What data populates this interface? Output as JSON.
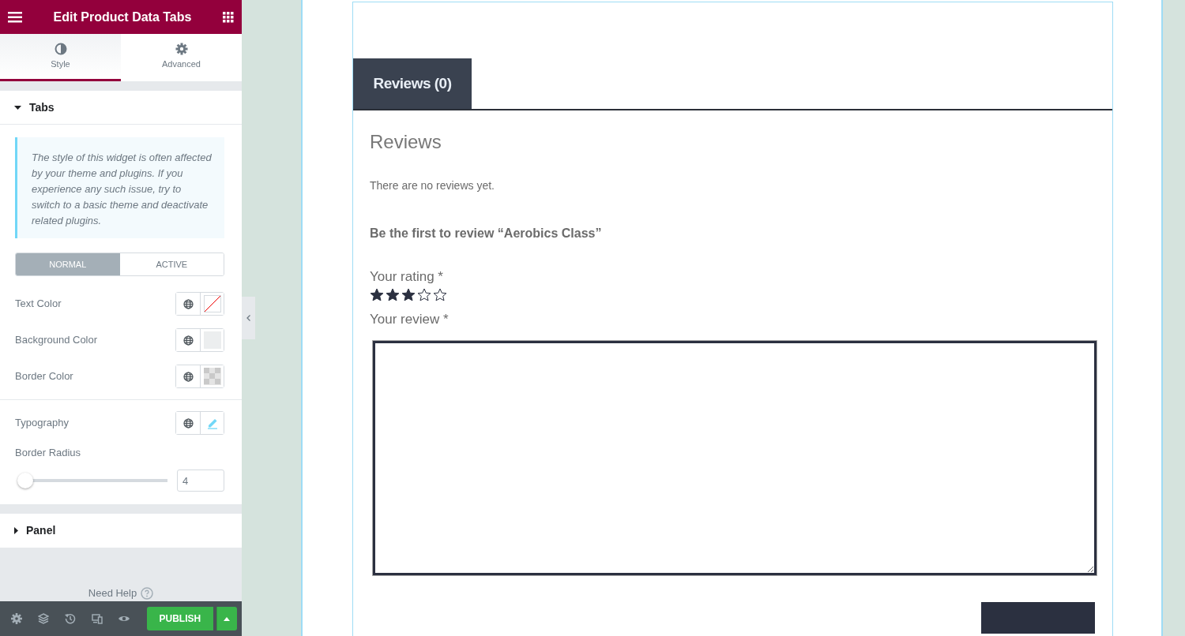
{
  "sidebar": {
    "title": "Edit Product Data Tabs",
    "tabs": [
      {
        "label": "Style",
        "kind": "style",
        "selected": true
      },
      {
        "label": "Advanced",
        "kind": "advanced",
        "selected": false
      }
    ],
    "sections": [
      {
        "title": "Tabs",
        "expanded": true,
        "notice": "The style of this widget is often affected by your theme and plugins. If you experience any such issue, try to switch to a basic theme and deactivate related plugins.",
        "state_toggle": [
          {
            "label": "NORMAL",
            "selected": true
          },
          {
            "label": "ACTIVE",
            "selected": false
          }
        ],
        "controls": [
          {
            "kind": "color",
            "label": "Text Color",
            "swatch": {
              "kind": "none"
            }
          },
          {
            "kind": "color",
            "label": "Background Color",
            "swatch": {
              "kind": "light"
            }
          },
          {
            "kind": "color",
            "label": "Border Color",
            "swatch": {
              "kind": "checker"
            }
          },
          {
            "kind": "typography",
            "label": "Typography"
          },
          {
            "kind": "slider",
            "label": "Border Radius",
            "level": 0.02,
            "value": "4"
          }
        ]
      },
      {
        "title": "Panel",
        "expanded": false
      }
    ],
    "need_help": "Need Help",
    "footer": {
      "publish": "PUBLISH"
    }
  },
  "preview": {
    "tabs": [
      {
        "label": "Reviews (0)",
        "selected": true
      }
    ],
    "heading": "Reviews",
    "empty_message": "There are no reviews yet.",
    "reply_title": "Be the first to review “Aerobics Class”",
    "rating_label": "Your rating *",
    "stars": 3,
    "review_label": "Your review *"
  }
}
